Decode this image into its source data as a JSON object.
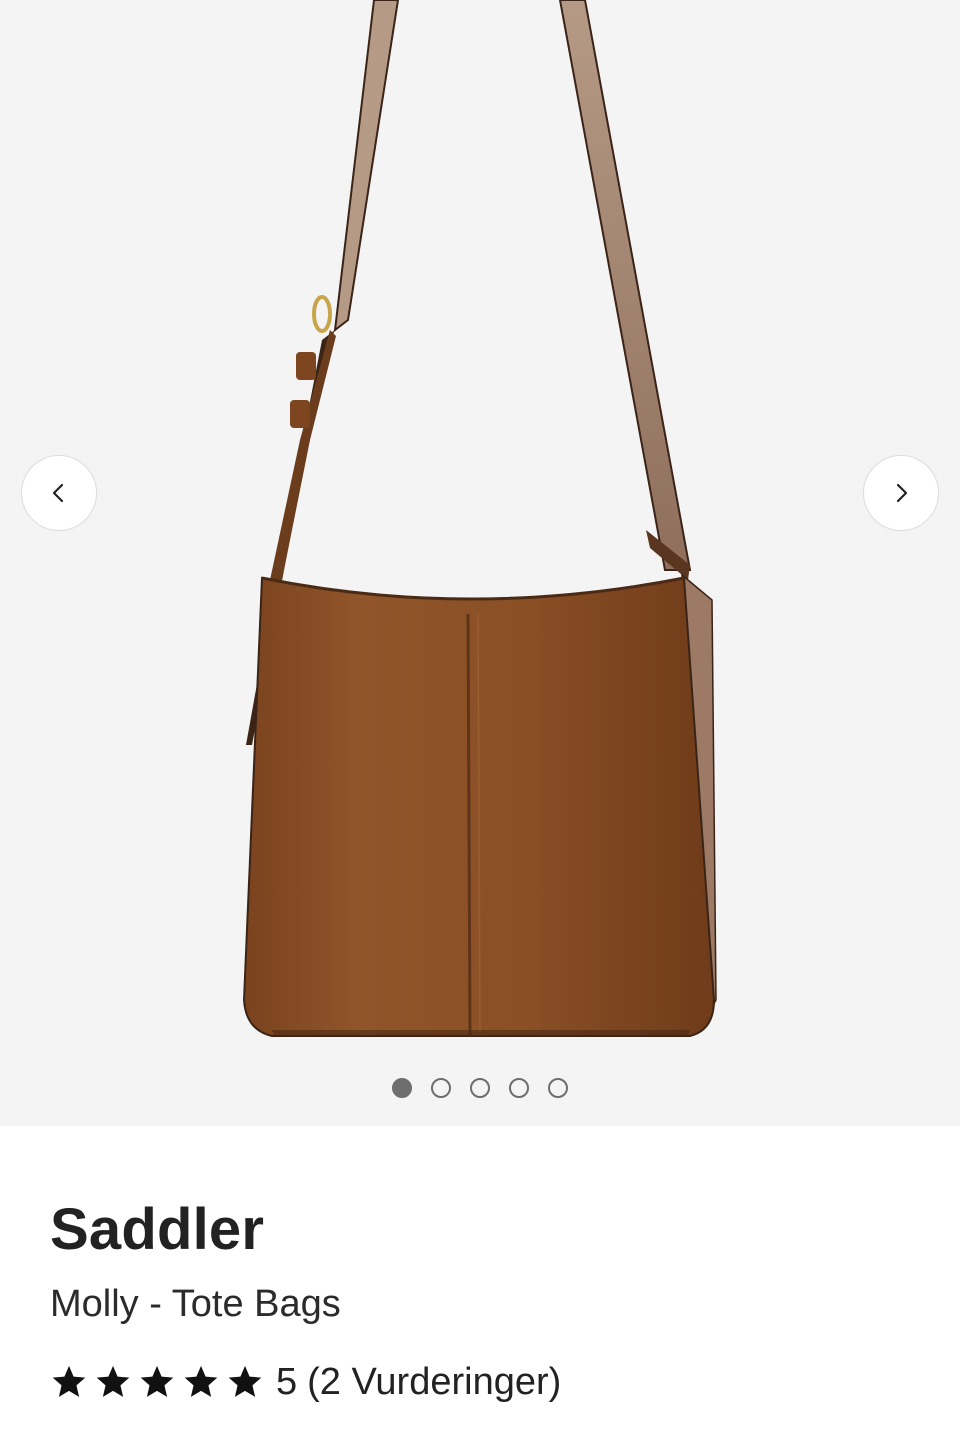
{
  "product": {
    "brand": "Saddler",
    "name": "Molly - Tote Bags",
    "image": {
      "subject": "brown leather shoulder bag",
      "color": "#8a4f26"
    },
    "rating": {
      "value": "5",
      "count_text": "(2 Vurderinger)",
      "stars_filled": 5,
      "stars_total": 5
    }
  },
  "gallery": {
    "slides": 5,
    "current_slide": 1,
    "prev_icon": "chevron-left-icon",
    "next_icon": "chevron-right-icon",
    "background": "#f4f4f4"
  },
  "colors": {
    "text": "#222222",
    "dot": "#6e6e6e",
    "star": "#111111"
  }
}
